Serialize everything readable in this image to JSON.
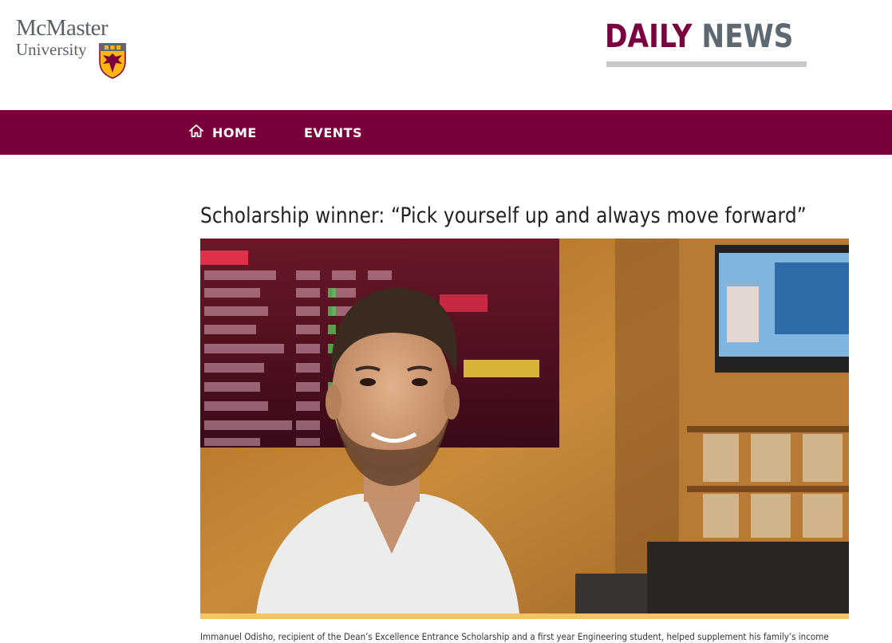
{
  "header": {
    "logo_line1": "McMaster",
    "logo_line2": "University",
    "site_title_part1": "DAILY",
    "site_title_part2": "NEWS"
  },
  "nav": {
    "items": [
      {
        "label": "HOME",
        "icon": "home-icon"
      },
      {
        "label": "EVENTS"
      }
    ]
  },
  "article": {
    "headline": "Scholarship winner: “Pick yourself up and always move forward”",
    "caption": "Immanuel Odisho, recipient of the Dean’s Excellence Entrance Scholarship and a first year Engineering student, helped supplement his family’s income"
  },
  "colors": {
    "brand_maroon": "#7a003c",
    "brand_gray": "#5f6870",
    "accent_gold": "#f2c462"
  }
}
